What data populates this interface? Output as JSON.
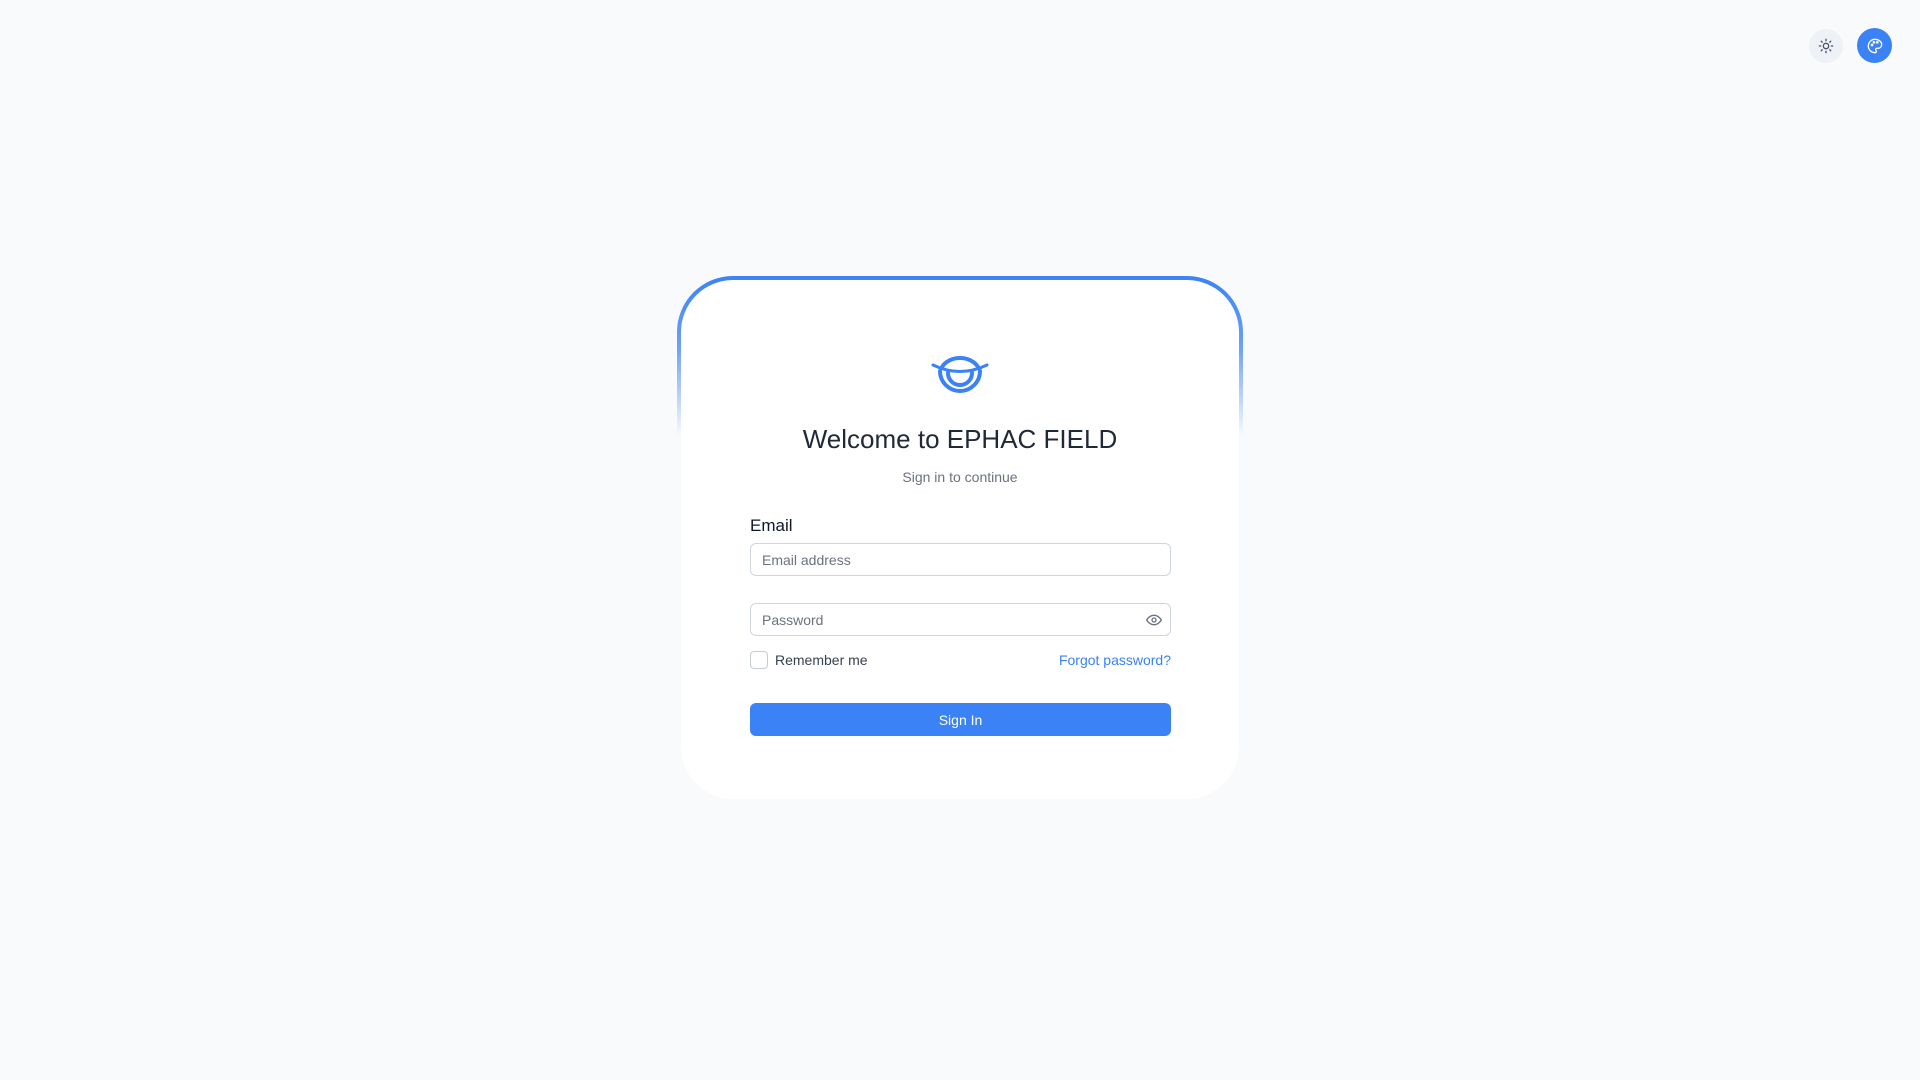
{
  "colors": {
    "accent": "#3b82f6",
    "background": "#f8fafc",
    "card": "#ffffff"
  },
  "top_actions": {
    "theme_toggle_icon": "sun-icon",
    "palette_icon": "palette-icon"
  },
  "login": {
    "logo_icon": "brand-logo-icon",
    "title": "Welcome to EPHAC FIELD",
    "subtitle": "Sign in to continue",
    "email_label": "Email",
    "email_placeholder": "Email address",
    "email_value": "",
    "password_placeholder": "Password",
    "password_value": "",
    "password_toggle_icon": "eye-icon",
    "remember_label": "Remember me",
    "remember_checked": false,
    "forgot_label": "Forgot password?",
    "signin_label": "Sign In"
  }
}
